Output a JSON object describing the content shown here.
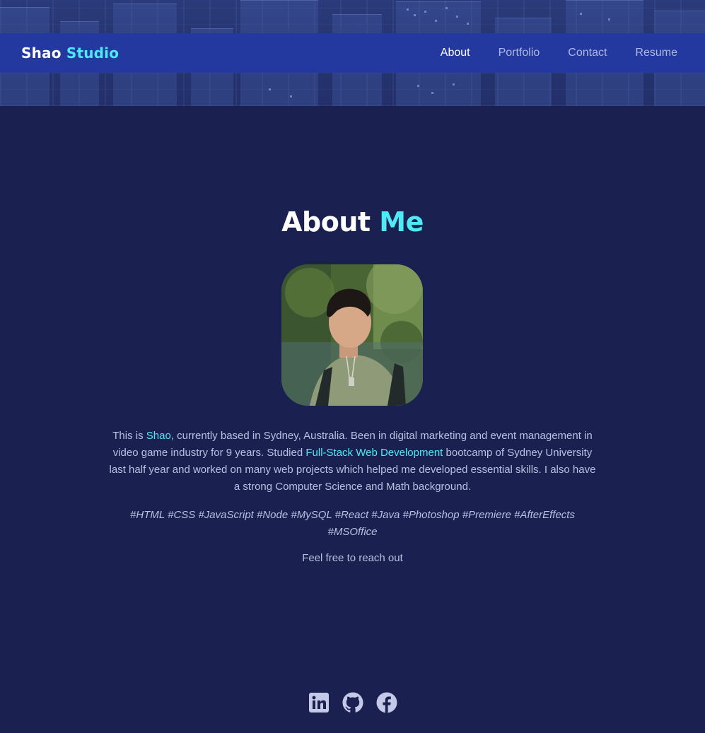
{
  "nav": {
    "brand_first": "Shao",
    "brand_second": "Studio",
    "links": [
      {
        "label": "About",
        "active": true
      },
      {
        "label": "Portfolio",
        "active": false
      },
      {
        "label": "Contact",
        "active": false
      },
      {
        "label": "Resume",
        "active": false
      }
    ]
  },
  "about": {
    "title_first": "About",
    "title_second": "Me",
    "bio": {
      "p1": "This is ",
      "name": "Shao",
      "p2": ", currently based in Sydney, Australia. Been in digital marketing and event management in video game industry for 9 years. Studied ",
      "course": "Full-Stack Web Development",
      "p3": " bootcamp of Sydney University last half year and worked on many web projects which helped me developed essential skills. I also have a strong Computer Science and Math background."
    },
    "tags": "#HTML #CSS #JavaScript #Node #MySQL #React #Java #Photoshop #Premiere #AfterEffects #MSOffice",
    "cta": "Feel free to reach out"
  },
  "socials": [
    {
      "icon": "linkedin-icon"
    },
    {
      "icon": "github-icon"
    },
    {
      "icon": "facebook-icon"
    }
  ],
  "colors": {
    "background": "#1a2150",
    "navbar": "#2439a0",
    "accent": "#4ee9f5",
    "text": "#b9c0e0",
    "icon": "#c3c9e6"
  }
}
